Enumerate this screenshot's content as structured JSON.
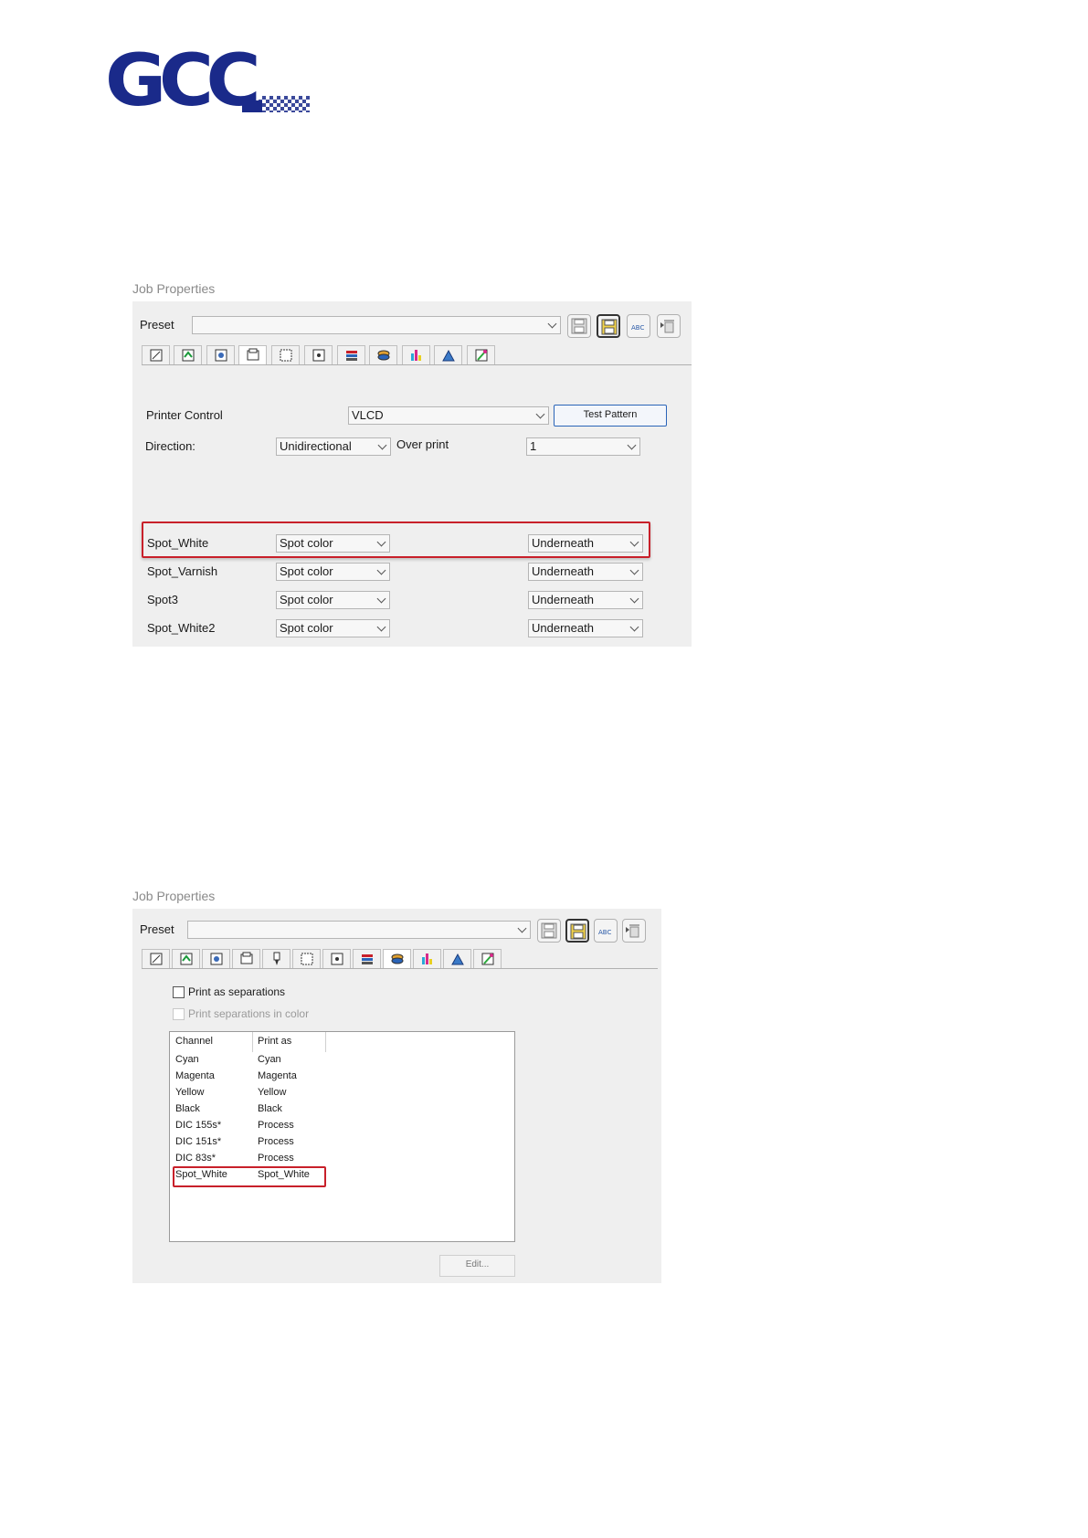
{
  "logo": {
    "text": "GCC"
  },
  "screenshot1": {
    "caption": "Job Properties",
    "preset_label": "Preset",
    "preset_value": "",
    "printer_control_label": "Printer Control",
    "printer_control_value": "VLCD",
    "test_pattern_label": "Test Pattern",
    "direction_label": "Direction:",
    "direction_value": "Unidirectional",
    "over_print_label": "Over print",
    "over_print_value": "1",
    "spot_rows": [
      {
        "name": "Spot_White",
        "mode": "Spot color",
        "placement": "Underneath"
      },
      {
        "name": "Spot_Varnish",
        "mode": "Spot color",
        "placement": "Underneath"
      },
      {
        "name": "Spot3",
        "mode": "Spot color",
        "placement": "Underneath"
      },
      {
        "name": "Spot_White2",
        "mode": "Spot color",
        "placement": "Underneath"
      }
    ]
  },
  "screenshot2": {
    "caption": "Job Properties",
    "preset_label": "Preset",
    "preset_value": "",
    "print_as_separations_label": "Print as separations",
    "print_separations_in_color_label": "Print separations in color",
    "columns": [
      "Channel",
      "Print as"
    ],
    "rows": [
      [
        "Cyan",
        "Cyan"
      ],
      [
        "Magenta",
        "Magenta"
      ],
      [
        "Yellow",
        "Yellow"
      ],
      [
        "Black",
        "Black"
      ],
      [
        "DIC 155s*",
        "Process"
      ],
      [
        "DIC 151s*",
        "Process"
      ],
      [
        "DIC 83s*",
        "Process"
      ],
      [
        "Spot_White",
        "Spot_White"
      ]
    ],
    "edit_label": "Edit..."
  },
  "colors": {
    "brand": "#1a2a8a",
    "highlight": "#c8202a",
    "dialog_bg": "#efefef"
  }
}
